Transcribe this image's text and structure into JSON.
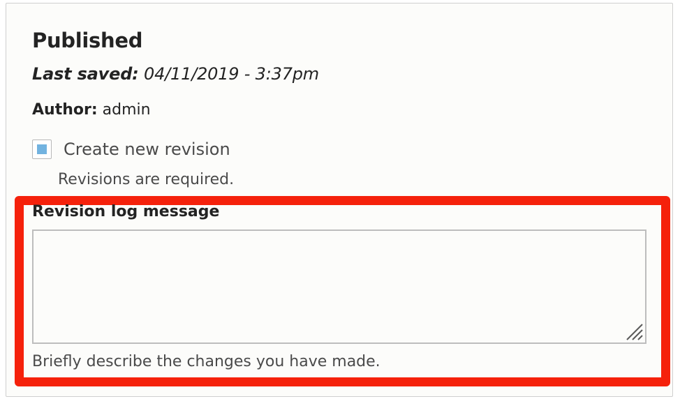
{
  "revision_panel": {
    "status": "Published",
    "last_saved_label": "Last saved:",
    "last_saved_value": "04/11/2019 - 3:37pm",
    "author_label": "Author:",
    "author_value": "admin",
    "create_revision": {
      "label": "Create new revision",
      "checked": true,
      "description": "Revisions are required."
    },
    "log_message": {
      "label": "Revision log message",
      "value": "",
      "description": "Briefly describe the changes you have made."
    }
  },
  "colors": {
    "highlight_border": "#f5210b",
    "checkbox_fill": "#72b3e0",
    "panel_background": "#fcfcfa"
  },
  "icons": {
    "textarea_resize": "resize-grip-icon"
  }
}
